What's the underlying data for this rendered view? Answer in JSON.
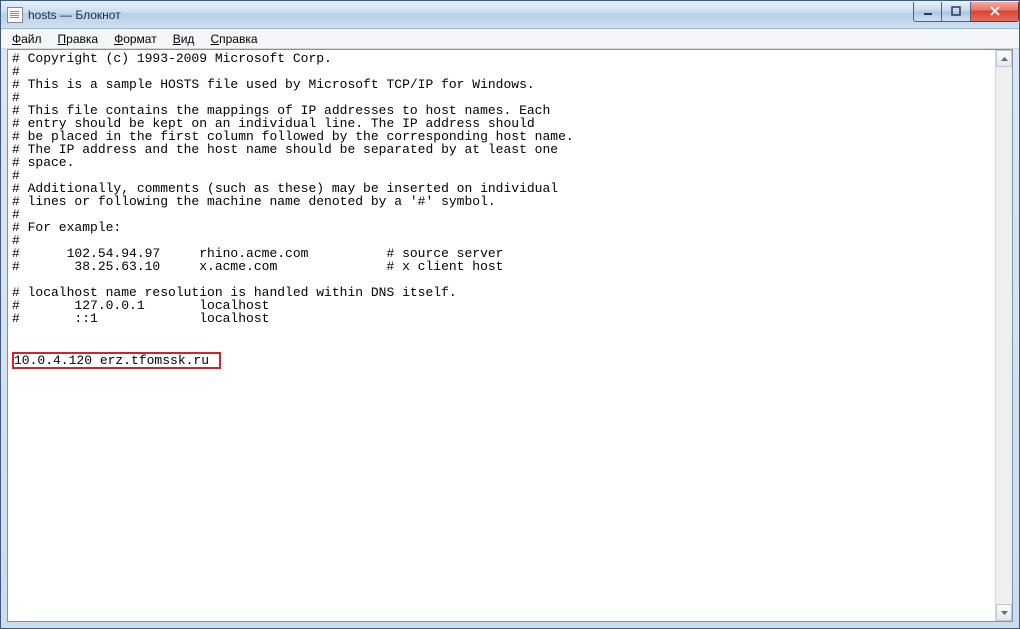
{
  "title": "hosts — Блокнот",
  "menus": {
    "file": {
      "label": "Файл",
      "ul": "Ф",
      "rest": "айл"
    },
    "edit": {
      "label": "Правка",
      "ul": "П",
      "rest": "равка"
    },
    "format": {
      "label": "Формат",
      "ul": "Ф",
      "rest": "ормат"
    },
    "view": {
      "label": "Вид",
      "ul": "В",
      "rest": "ид"
    },
    "help": {
      "label": "Справка",
      "ul": "С",
      "rest": "правка"
    }
  },
  "content_lines": [
    "# Copyright (c) 1993-2009 Microsoft Corp.",
    "#",
    "# This is a sample HOSTS file used by Microsoft TCP/IP for Windows.",
    "#",
    "# This file contains the mappings of IP addresses to host names. Each",
    "# entry should be kept on an individual line. The IP address should",
    "# be placed in the first column followed by the corresponding host name.",
    "# The IP address and the host name should be separated by at least one",
    "# space.",
    "#",
    "# Additionally, comments (such as these) may be inserted on individual",
    "# lines or following the machine name denoted by a '#' symbol.",
    "#",
    "# For example:",
    "#",
    "#      102.54.94.97     rhino.acme.com          # source server",
    "#       38.25.63.10     x.acme.com              # x client host",
    "",
    "# localhost name resolution is handled within DNS itself.",
    "#       127.0.0.1       localhost",
    "#       ::1             localhost",
    "",
    ""
  ],
  "highlighted_line": "10.0.4.120 erz.tfomssk.ru "
}
